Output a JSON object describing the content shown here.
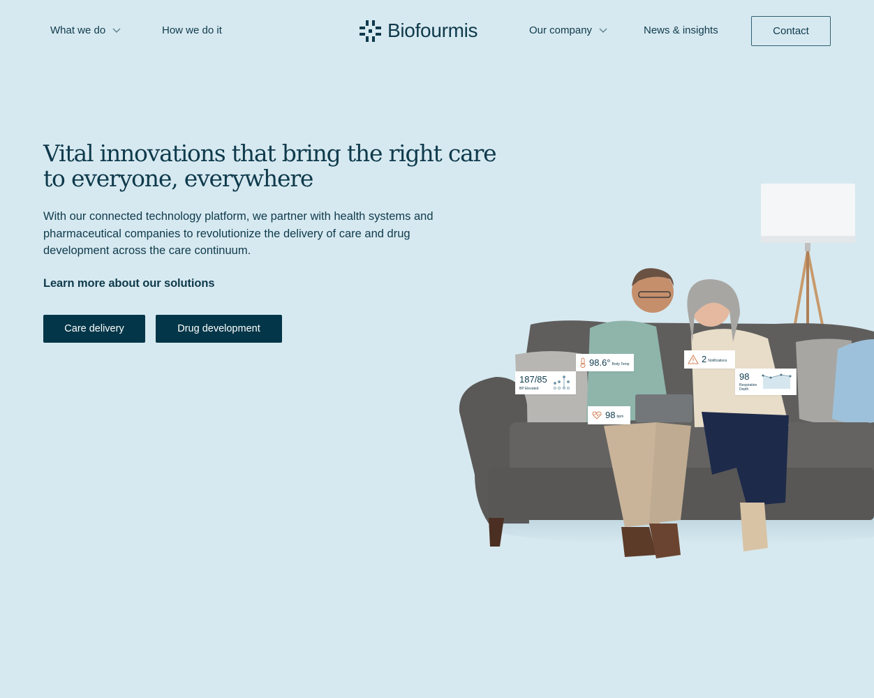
{
  "colors": {
    "background": "#d7e9f0",
    "text": "#0e3a4c",
    "button_bg": "#023648",
    "button_text": "#ffffff",
    "alert_orange": "#d2835a"
  },
  "header": {
    "nav_left": [
      {
        "label": "What we do",
        "has_dropdown": true,
        "icon": "chevron-down-icon"
      },
      {
        "label": "How we do it",
        "has_dropdown": false
      }
    ],
    "logo": {
      "text": "Biofourmis",
      "icon": "biofourmis-logo-icon"
    },
    "nav_right": [
      {
        "label": "Our company",
        "has_dropdown": true,
        "icon": "chevron-down-icon"
      },
      {
        "label": "News & insights",
        "has_dropdown": false
      }
    ],
    "contact_label": "Contact"
  },
  "hero": {
    "title": "Vital innovations that bring the right care to everyone, everywhere",
    "description": "With our connected technology platform, we partner with health systems and pharmaceutical companies to revolutionize the delivery of care and drug development across the care continuum.",
    "learn_more": "Learn more about our solutions",
    "buttons": [
      {
        "label": "Care delivery"
      },
      {
        "label": "Drug development"
      }
    ]
  },
  "illustration": {
    "alt": "Senior couple sitting on a couch looking at a tablet, with health metric cards overlaid",
    "metrics": [
      {
        "name": "bp",
        "value": "187/85",
        "label": "BP Elevated",
        "icon": "bp-dots-chart-icon"
      },
      {
        "name": "temp",
        "value": "98.6°",
        "label": "Body Temp",
        "icon": "thermometer-icon"
      },
      {
        "name": "notifications",
        "value": "2",
        "label": "Notifications",
        "icon": "warning-icon"
      },
      {
        "name": "respiration",
        "value": "98",
        "label": "Respiration Depth",
        "icon": "respiration-chart-icon"
      },
      {
        "name": "heart",
        "value": "98",
        "label": "bpm",
        "icon": "heart-rate-icon"
      }
    ]
  }
}
